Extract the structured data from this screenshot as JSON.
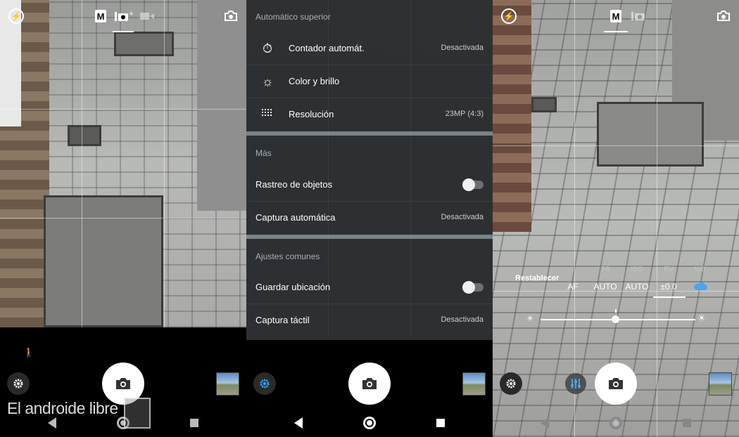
{
  "panel1": {
    "mode_m": "M",
    "watermark": "El androide libre"
  },
  "settings": {
    "sections": [
      {
        "header": "Automático superior"
      },
      {
        "header": "Más"
      },
      {
        "header": "Ajustes comunes"
      }
    ],
    "rows": [
      {
        "label": "Contador automát.",
        "value": "Desactivada",
        "icon": "timer-icon"
      },
      {
        "label": "Color y brillo",
        "value": "",
        "icon": "brightness-icon"
      },
      {
        "label": "Resolución",
        "value": "23MP (4:3)",
        "icon": "resolution-grid-icon"
      },
      {
        "label": "Rastreo de objetos",
        "toggle": false
      },
      {
        "label": "Captura automática",
        "value": "Desactivada"
      },
      {
        "label": "Guardar ubicación",
        "toggle": false
      },
      {
        "label": "Captura táctil",
        "value": "Desactivada"
      }
    ]
  },
  "manual": {
    "mode_m": "M",
    "reset": "Restablecer",
    "controls": [
      {
        "label": "",
        "value": "AF"
      },
      {
        "label": "SS",
        "value": "AUTO"
      },
      {
        "label": "ISO",
        "value": "AUTO"
      },
      {
        "label": "EV",
        "value": "±0.0"
      },
      {
        "label": "WB",
        "value": ""
      }
    ],
    "ev_level": 0.5
  },
  "colors": {
    "accent": "#4aa3f0",
    "menu_bg": "#2d3032"
  }
}
